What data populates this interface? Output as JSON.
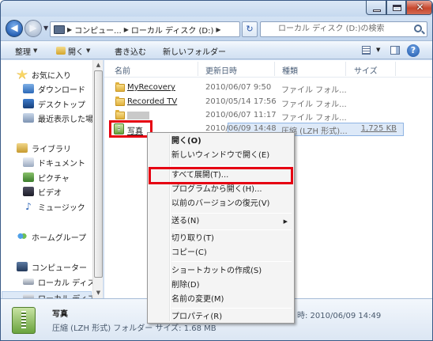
{
  "window": {
    "close_glyph": "✕"
  },
  "nav": {
    "back_glyph": "◀",
    "forward_glyph": "▶",
    "breadcrumb": [
      "コンピュー...",
      "ローカル ディスク (D:)"
    ],
    "search_placeholder": "ローカル ディスク (D:)の検索",
    "refresh_glyph": "↻"
  },
  "toolbar": {
    "organize": "整理",
    "open": "開く",
    "burn": "書き込む",
    "new_folder": "新しいフォルダー",
    "help": "?"
  },
  "sidebar": {
    "favorites_label": "お気に入り",
    "favorites": [
      "ダウンロード",
      "デスクトップ",
      "最近表示した場所"
    ],
    "libraries_label": "ライブラリ",
    "libraries": [
      "ドキュメント",
      "ピクチャ",
      "ビデオ",
      "ミュージック"
    ],
    "homegroup_label": "ホームグループ",
    "computer_label": "コンピューター",
    "computer": [
      "ローカル ディス",
      "ローカル ディス"
    ]
  },
  "columns": {
    "name": "名前",
    "date": "更新日時",
    "type": "種類",
    "size": "サイズ"
  },
  "files": [
    {
      "name": "MyRecovery",
      "date": "2010/06/07 9:50",
      "type": "ファイル フォル...",
      "size": ""
    },
    {
      "name": "Recorded TV",
      "date": "2010/05/14 17:56",
      "type": "ファイル フォル...",
      "size": ""
    },
    {
      "name": "",
      "date": "2010/06/07 11:17",
      "type": "ファイル フォル...",
      "size": ""
    },
    {
      "name": "写真",
      "date": "2010/06/09 14:48",
      "type": "圧縮 (LZH 形式)...",
      "size": "1,725 KB"
    }
  ],
  "context_menu": {
    "items": [
      {
        "label": "開く(O)",
        "bold": true
      },
      {
        "label": "新しいウィンドウで開く(E)"
      },
      {
        "label": "すべて展開(T)..."
      },
      {
        "label": "プログラムから開く(H)..."
      },
      {
        "label": "以前のバージョンの復元(V)"
      },
      {
        "label": "送る(N)",
        "submenu": true
      },
      {
        "label": "切り取り(T)"
      },
      {
        "label": "コピー(C)"
      },
      {
        "label": "ショートカットの作成(S)"
      },
      {
        "label": "削除(D)"
      },
      {
        "label": "名前の変更(M)"
      },
      {
        "label": "プロパティ(R)"
      }
    ],
    "submenu_glyph": "▶"
  },
  "details": {
    "name": "写真",
    "type": "圧縮 (LZH 形式) フォルダー  サイズ: 1.68 MB",
    "modified": "時: 2010/06/09 14:49"
  },
  "colors": {
    "highlight_red": "#e60012",
    "selection": "#dde9f8"
  }
}
